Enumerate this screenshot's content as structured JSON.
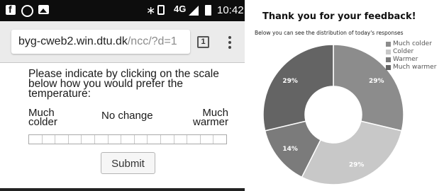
{
  "status_bar": {
    "icons": [
      "facebook-icon",
      "whatsapp-icon",
      "image-icon",
      "bluetooth-icon",
      "vibrate-icon",
      "signal-icon",
      "battery-icon"
    ],
    "bluetooth_glyph": "∗",
    "network": "4G",
    "time": "10:42"
  },
  "browser": {
    "url_host": "byg-cweb2.win.dtu.dk",
    "url_path": "/ncc/?d=1",
    "tab_count": "1"
  },
  "survey": {
    "instruction": "Please indicate by clicking on the scale below how you would prefer the temperature:",
    "label_colder": "Much colder",
    "label_nochange": "No change",
    "label_warmer": "Much warmer",
    "scale_steps": 15,
    "submit_label": "Submit"
  },
  "results": {
    "title": "Thank you for your feedback!",
    "subtitle": "Below you can see the distribution of today's responses"
  },
  "chart_data": {
    "type": "pie",
    "variant": "donut",
    "categories": [
      "Much colder",
      "Colder",
      "Warmer",
      "Much warmer"
    ],
    "values": [
      29,
      29,
      14,
      29
    ],
    "value_labels": [
      "29%",
      "29%",
      "14%",
      "29%"
    ],
    "colors": [
      "#8c8c8c",
      "#c8c8c8",
      "#7b7b7b",
      "#646464"
    ],
    "legend_position": "top-right"
  }
}
